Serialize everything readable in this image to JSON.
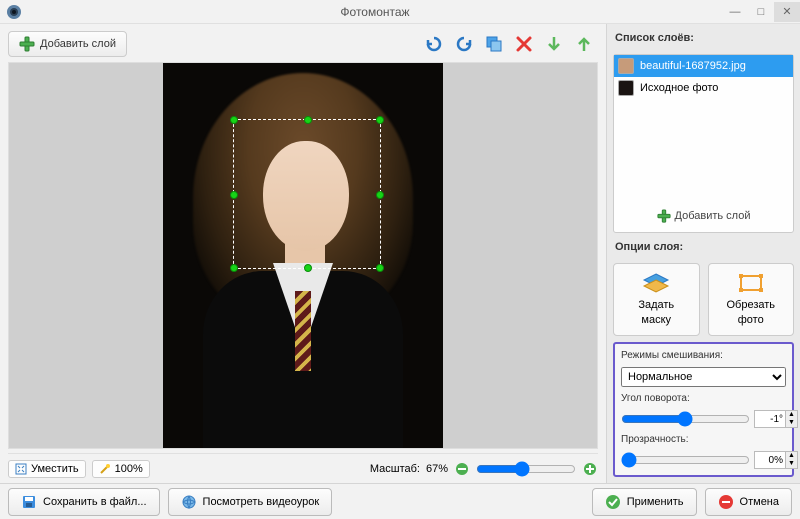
{
  "window": {
    "title": "Фотомонтаж"
  },
  "toolbar": {
    "add_layer": "Добавить слой"
  },
  "layers_panel": {
    "title": "Список слоёв:",
    "items": [
      {
        "label": "beautiful-1687952.jpg",
        "selected": true
      },
      {
        "label": "Исходное фото",
        "selected": false
      }
    ],
    "add_layer": "Добавить слой"
  },
  "options_panel": {
    "title": "Опции слоя:",
    "mask_button": "Задать\nмаску",
    "crop_button": "Обрезать\nфото"
  },
  "blend": {
    "mode_label": "Режимы смешивания:",
    "mode_value": "Нормальное",
    "angle_label": "Угол поворота:",
    "angle_value": "-1°",
    "opacity_label": "Прозрачность:",
    "opacity_value": "0%"
  },
  "status": {
    "fit": "Уместить",
    "hundred": "100%",
    "zoom_label": "Масштаб:",
    "zoom_value": "67%"
  },
  "bottombar": {
    "save": "Сохранить в файл...",
    "video": "Посмотреть видеоурок",
    "apply": "Применить",
    "cancel": "Отмена"
  }
}
